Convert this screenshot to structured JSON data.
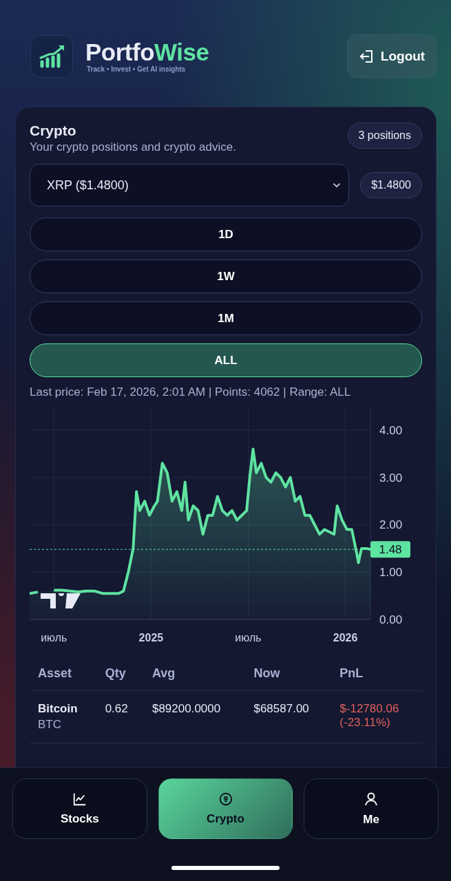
{
  "header": {
    "brand_first": "Portfo",
    "brand_second": "Wise",
    "tagline": "Track • Invest • Get AI insights",
    "logout": "Logout"
  },
  "card": {
    "title": "Crypto",
    "subtitle": "Your crypto positions and crypto advice.",
    "count_badge": "3 positions",
    "asset_select": {
      "value": "XRP ($1.4800)"
    },
    "price_badge": "$1.4800",
    "ranges": [
      {
        "label": "1D",
        "selected": false
      },
      {
        "label": "1W",
        "selected": false
      },
      {
        "label": "1M",
        "selected": false
      },
      {
        "label": "ALL",
        "selected": true
      }
    ],
    "info": "Last price: Feb 17, 2026, 2:01 AM | Points: 4062 | Range: ALL",
    "chart_data": {
      "type": "area",
      "x": [
        2024.375,
        2024.417,
        2024.458,
        2024.5,
        2024.542,
        2024.583,
        2024.625,
        2024.667,
        2024.708,
        2024.75,
        2024.792,
        2024.833,
        2024.858,
        2024.883,
        2024.908,
        2024.925,
        2024.942,
        2024.967,
        2024.992,
        2025.017,
        2025.033,
        2025.058,
        2025.083,
        2025.108,
        2025.133,
        2025.158,
        2025.175,
        2025.192,
        2025.217,
        2025.242,
        2025.267,
        2025.292,
        2025.317,
        2025.342,
        2025.367,
        2025.392,
        2025.417,
        2025.442,
        2025.467,
        2025.492,
        2025.508,
        2025.525,
        2025.542,
        2025.567,
        2025.592,
        2025.617,
        2025.642,
        2025.667,
        2025.692,
        2025.717,
        2025.742,
        2025.767,
        2025.792,
        2025.817,
        2025.842,
        2025.867,
        2025.892,
        2025.917,
        2025.942,
        2025.958,
        2025.983,
        2026.008,
        2026.033,
        2026.058,
        2026.067,
        2026.083,
        2026.108,
        2026.129
      ],
      "series": [
        {
          "color": "#5fe3a1",
          "values": [
            0.55,
            0.58,
            null,
            0.62,
            0.62,
            0.6,
            0.58,
            0.6,
            0.6,
            0.55,
            0.55,
            0.55,
            0.6,
            1.0,
            1.5,
            2.7,
            2.3,
            2.5,
            2.2,
            2.4,
            2.5,
            3.3,
            3.1,
            2.5,
            2.7,
            2.3,
            2.9,
            2.1,
            2.4,
            2.3,
            1.8,
            2.2,
            2.2,
            2.6,
            2.3,
            2.2,
            2.3,
            2.1,
            2.2,
            2.3,
            3.0,
            3.6,
            3.1,
            3.3,
            3.0,
            2.9,
            3.1,
            3.0,
            2.8,
            3.0,
            2.5,
            2.6,
            2.2,
            2.2,
            2.0,
            1.8,
            1.9,
            1.85,
            1.8,
            2.4,
            2.1,
            1.9,
            1.9,
            1.4,
            1.2,
            1.5,
            1.5,
            1.48
          ]
        }
      ],
      "xlim": [
        2024.375,
        2026.129
      ],
      "ylim": [
        0,
        4.45
      ],
      "xticks": [
        {
          "value": 2024.5,
          "label": "июль"
        },
        {
          "value": 2025,
          "label": "2025"
        },
        {
          "value": 2025.5,
          "label": "июль"
        },
        {
          "value": 2026,
          "label": "2026"
        }
      ],
      "yticks": [
        {
          "value": 0,
          "label": "0.00"
        },
        {
          "value": 1,
          "label": "1.00"
        },
        {
          "value": 2,
          "label": "2.00"
        },
        {
          "value": 3,
          "label": "3.00"
        },
        {
          "value": 4,
          "label": "4.00"
        }
      ],
      "grid": true,
      "ref_lines": [
        {
          "axis": "y",
          "value": 1.48,
          "label": "1.48",
          "color": "#5fe3a1"
        }
      ]
    },
    "table": {
      "columns": [
        "Asset",
        "Qty",
        "Avg",
        "Now",
        "PnL"
      ],
      "rows": [
        {
          "name": "Bitcoin",
          "symbol": "BTC",
          "qty": "0.62",
          "avg": "$89200.0000",
          "now": "$68587.00",
          "pnl": "$-12780.06",
          "pnl_pct": "(-23.11%)",
          "color": "#e2605e"
        }
      ]
    }
  },
  "nav": [
    {
      "label": "Stocks",
      "kind": "chart",
      "selected": false
    },
    {
      "label": "Crypto",
      "kind": "coin",
      "selected": true
    },
    {
      "label": "Me",
      "kind": "person",
      "selected": false
    }
  ]
}
